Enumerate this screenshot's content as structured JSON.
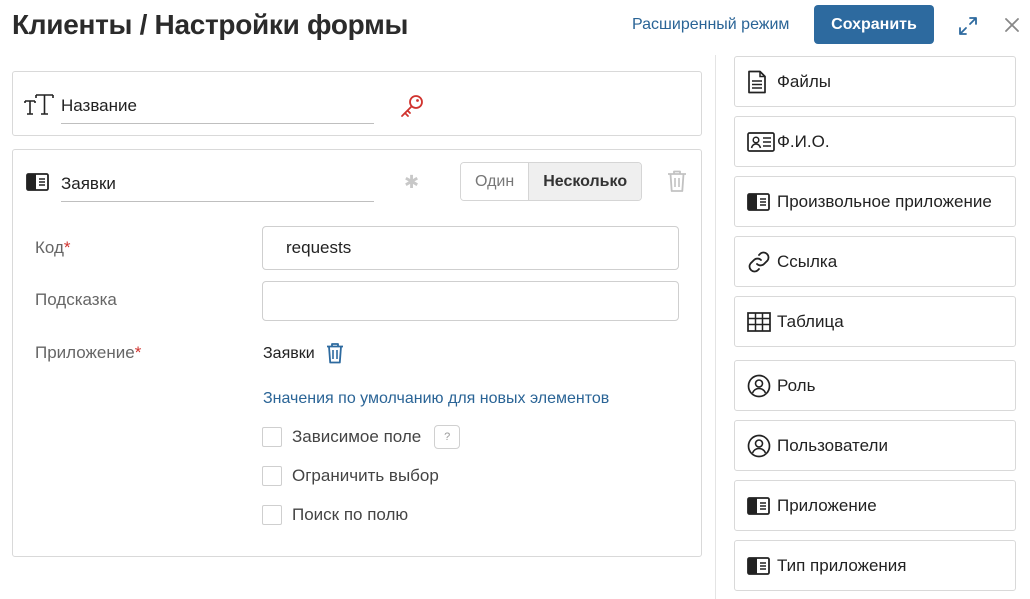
{
  "header": {
    "title": "Клиенты / Настройки формы",
    "advanced_mode": "Расширенный режим",
    "save_label": "Сохранить"
  },
  "name_field": {
    "value": "Название"
  },
  "requests_field": {
    "value": "Заявки",
    "mode_single": "Один",
    "mode_multiple": "Несколько",
    "selected_mode": "Несколько",
    "code_label": "Код",
    "code_value": "requests",
    "hint_label": "Подсказка",
    "hint_value": "",
    "app_label": "Приложение",
    "app_value": "Заявки",
    "defaults_link": "Значения по умолчанию для новых элементов",
    "required_mark": "*",
    "options": [
      {
        "label": "Зависимое поле",
        "checked": false,
        "help": "?"
      },
      {
        "label": "Ограничить выбор",
        "checked": false
      },
      {
        "label": "Поиск по полю",
        "checked": false
      }
    ]
  },
  "palette": {
    "items": [
      {
        "label": "Файлы",
        "icon": "file-icon"
      },
      {
        "label": "Ф.И.О.",
        "icon": "id-card-icon"
      },
      {
        "label": "Произвольное приложение",
        "icon": "app-icon"
      },
      {
        "label": "Ссылка",
        "icon": "link-icon"
      },
      {
        "label": "Таблица",
        "icon": "table-icon"
      },
      {
        "label": "Роль",
        "icon": "user-circle-icon"
      },
      {
        "label": "Пользователи",
        "icon": "user-circle-icon"
      },
      {
        "label": "Приложение",
        "icon": "app-icon"
      },
      {
        "label": "Тип приложения",
        "icon": "app-icon"
      }
    ]
  },
  "colors": {
    "primary": "#2d6a9f",
    "link": "#2a6496",
    "required": "#d0332e",
    "key": "#d0332e"
  }
}
